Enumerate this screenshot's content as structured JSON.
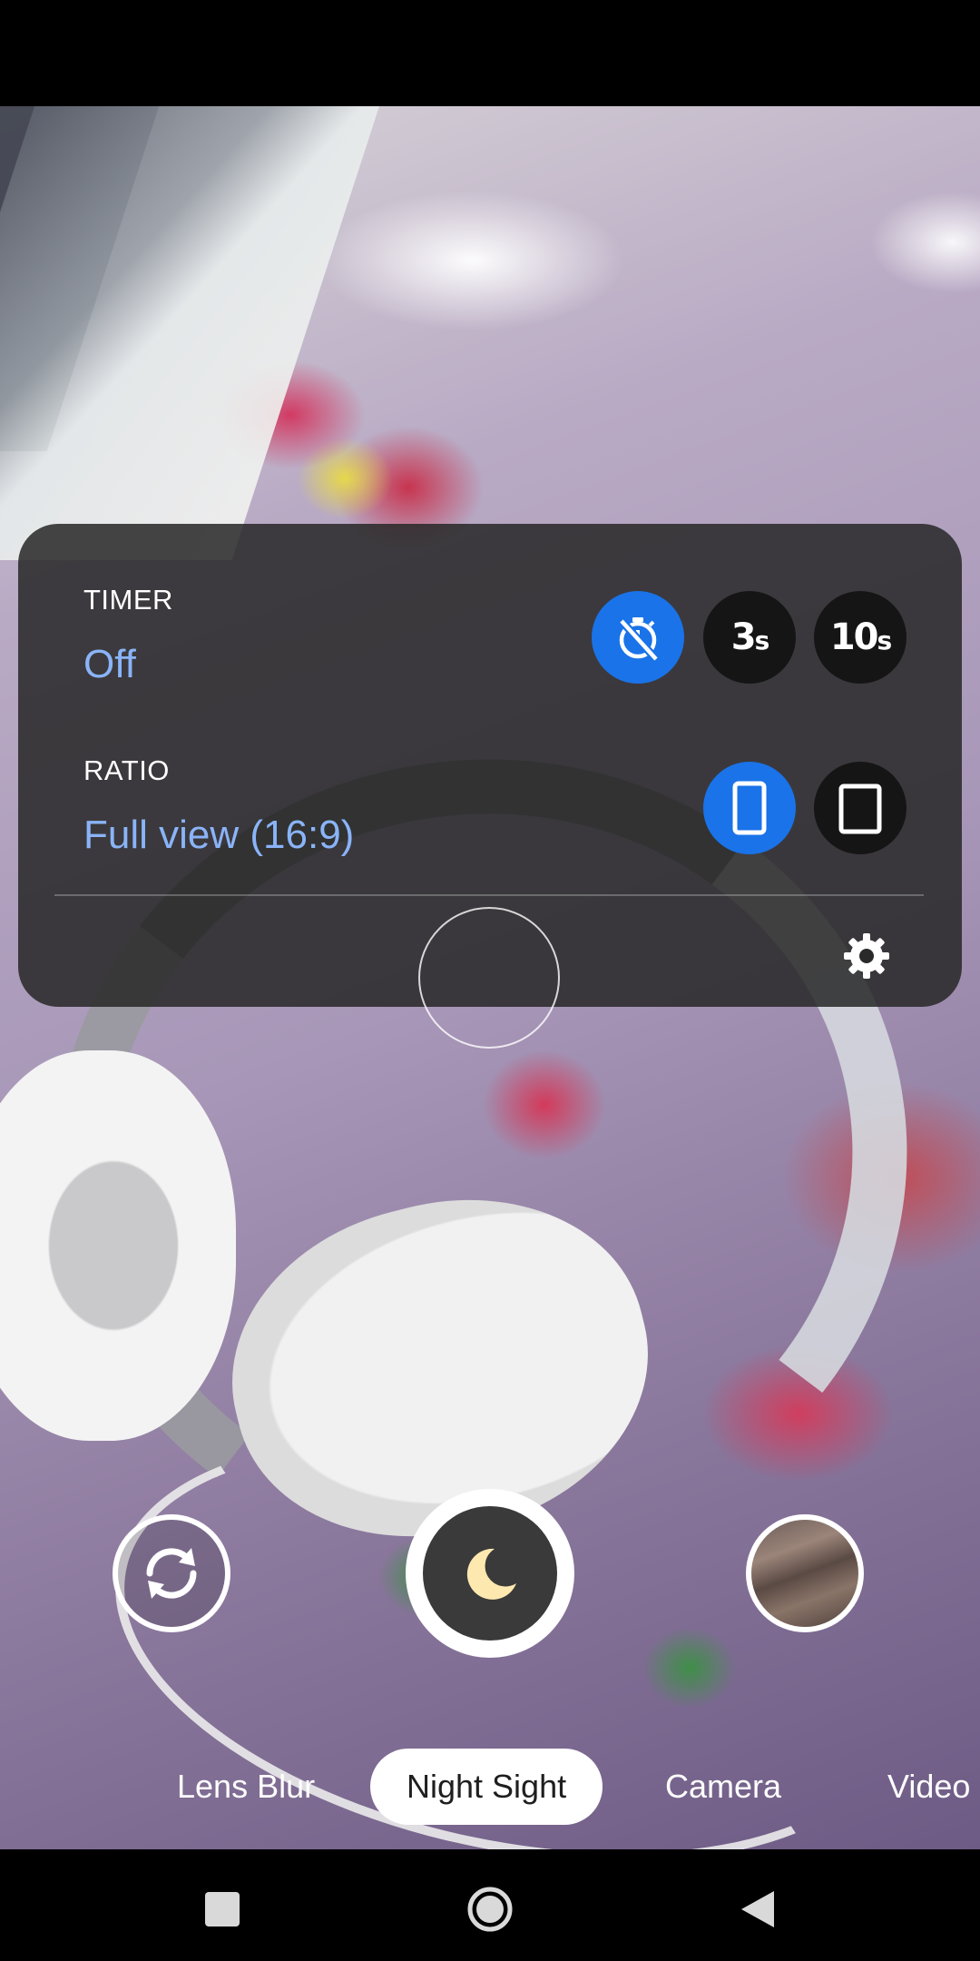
{
  "settings": {
    "timer": {
      "label": "TIMER",
      "value": "Off",
      "options": [
        {
          "name": "timer-off",
          "icon": "timer-off-icon",
          "selected": true
        },
        {
          "name": "timer-3s",
          "text_num": "3",
          "text_unit": "s",
          "selected": false
        },
        {
          "name": "timer-10s",
          "text_num": "10",
          "text_unit": "s",
          "selected": false
        }
      ]
    },
    "ratio": {
      "label": "RATIO",
      "value": "Full view (16:9)",
      "options": [
        {
          "name": "ratio-full",
          "icon": "portrait-tall-icon",
          "selected": true
        },
        {
          "name": "ratio-4-3",
          "icon": "portrait-short-icon",
          "selected": false
        }
      ]
    },
    "more_settings_icon": "gear-icon"
  },
  "controls": {
    "switch_camera_icon": "switch-camera-icon",
    "shutter_icon": "moon-icon",
    "gallery_thumbnail": "thumbnail"
  },
  "modes": [
    "Lens Blur",
    "Night Sight",
    "Camera",
    "Video"
  ],
  "active_mode": "Night Sight",
  "colors": {
    "accent": "#1a73e8",
    "value_text": "#8ab4f8",
    "moon": "#fde9b0"
  },
  "nav": [
    "recents-icon",
    "home-icon",
    "back-icon"
  ]
}
